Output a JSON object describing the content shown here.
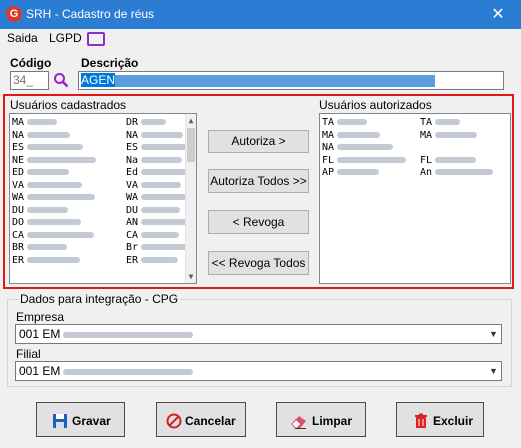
{
  "window": {
    "title": "SRH - Cadastro de réus",
    "icon_letter": "G",
    "close_glyph": "✕"
  },
  "menu": {
    "items": [
      "Saida",
      "LGPD"
    ]
  },
  "fields": {
    "codigo_label": "Código",
    "codigo_value": "34_",
    "descricao_label": "Descrição",
    "descricao_value": "AGEN"
  },
  "lists": {
    "cadastrados": {
      "label": "Usuários cadastrados",
      "rows": [
        [
          "MA",
          "DR"
        ],
        [
          "NA",
          "NA"
        ],
        [
          "ES",
          "ES"
        ],
        [
          "NE",
          "Na"
        ],
        [
          "ED",
          "Ed"
        ],
        [
          "VA",
          "VA"
        ],
        [
          "WA",
          "WA"
        ],
        [
          "DU",
          "DU"
        ],
        [
          "DO",
          "AN"
        ],
        [
          "CA",
          "CA"
        ],
        [
          "BR",
          "Br"
        ],
        [
          "ER",
          "ER"
        ],
        [
          "",
          ""
        ]
      ]
    },
    "autorizados": {
      "label": "Usuários autorizados",
      "rows": [
        [
          "TA",
          "TA"
        ],
        [
          "MA",
          "MA"
        ],
        [
          "NA",
          ""
        ],
        [
          "FL",
          "FL"
        ],
        [
          "AP",
          "An"
        ]
      ]
    }
  },
  "actions": {
    "autoriza": "Autoriza >",
    "autoriza_todos": "Autoriza Todos >>",
    "revoga": "< Revoga",
    "revoga_todos": "<< Revoga Todos"
  },
  "integracao": {
    "group_label": "Dados para integração - CPG",
    "empresa_label": "Empresa",
    "empresa_value": "001 EM",
    "filial_label": "Filial",
    "filial_value": "001 EM"
  },
  "buttons": {
    "gravar": "Gravar",
    "cancelar": "Cancelar",
    "limpar": "Limpar",
    "excluir": "Excluir"
  },
  "colors": {
    "titlebar": "#2b7cd3",
    "highlight": "#0078d7",
    "frame_red": "#e01818",
    "lgpd_icon": "#8b2fc9"
  }
}
